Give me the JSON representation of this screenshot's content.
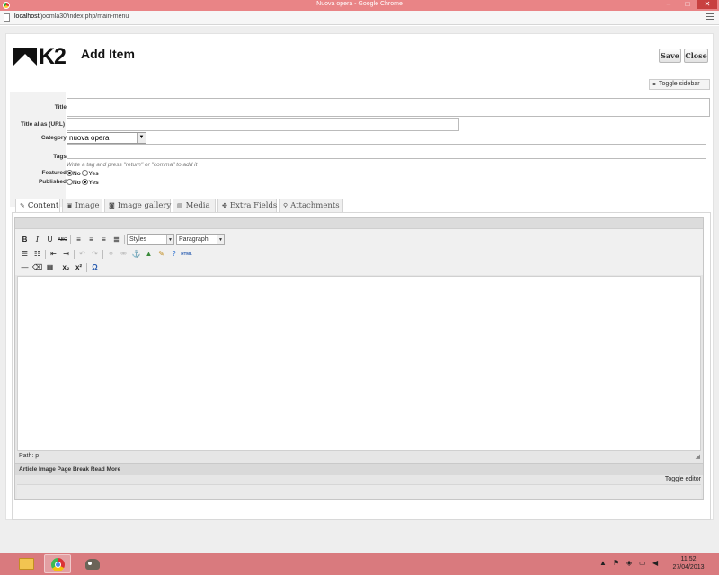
{
  "browser": {
    "window_title": "Nuova opera - Google Chrome",
    "url_host": "localhost",
    "url_path": "/joomla30/index.php/main-menu",
    "min_glyph": "–",
    "max_glyph": "□",
    "close_glyph": "✕"
  },
  "header": {
    "logo_text": "K2",
    "page_title": "Add Item",
    "save_label": "Save",
    "close_label": "Close",
    "toggle_sidebar_label": "Toggle sidebar"
  },
  "form": {
    "title_label": "Title",
    "title_value": "",
    "alias_label": "Title alias (URL)",
    "alias_value": "",
    "category_label": "Category",
    "category_value": "nuova opera",
    "tags_label": "Tags",
    "tags_value": "",
    "tags_hint": "Write a tag and press \"return\" or \"comma\" to add it",
    "featured_label": "Featured",
    "featured_selected": "No",
    "published_label": "Published",
    "published_selected": "Yes",
    "no_label": "No",
    "yes_label": "Yes"
  },
  "tabs": [
    {
      "label": "Content",
      "icon": "edit-icon",
      "active": true
    },
    {
      "label": "Image",
      "icon": "image-icon",
      "active": false
    },
    {
      "label": "Image gallery",
      "icon": "camera-icon",
      "active": false
    },
    {
      "label": "Media",
      "icon": "film-icon",
      "active": false
    },
    {
      "label": "Extra Fields",
      "icon": "puzzle-icon",
      "active": false
    },
    {
      "label": "Attachments",
      "icon": "paperclip-icon",
      "active": false
    }
  ],
  "editor": {
    "styles_select": "Styles",
    "format_select": "Paragraph",
    "path_text": "Path: p",
    "extras_bar_text": "Article Image Page Break Read More",
    "toggle_editor_label": "Toggle editor",
    "buttons": {
      "bold": "B",
      "italic": "I",
      "underline": "U",
      "strike": "ABC",
      "subscript": "x₂",
      "superscript": "x²",
      "omega": "Ω",
      "html": "HTML"
    }
  },
  "taskbar": {
    "time": "11.52",
    "date": "27/04/2013"
  }
}
